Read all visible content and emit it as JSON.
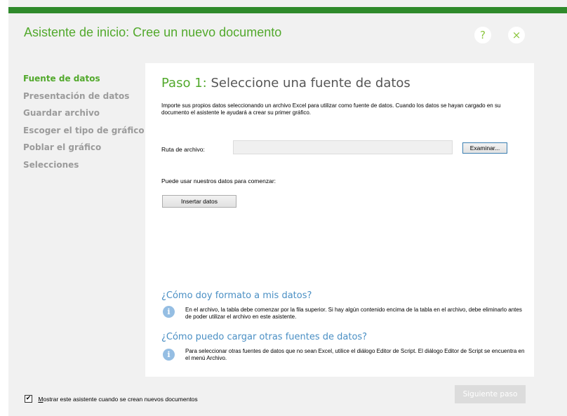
{
  "window": {
    "title": "Asistente de inicio: Cree un nuevo documento",
    "help_label": "?",
    "close_label": "×"
  },
  "sidebar": {
    "steps": [
      {
        "label": "Fuente de datos",
        "active": true
      },
      {
        "label": "Presentación de datos",
        "active": false
      },
      {
        "label": "Guardar archivo",
        "active": false
      },
      {
        "label": "Escoger el tipo de gráfico",
        "active": false
      },
      {
        "label": "Poblar el gráfico",
        "active": false
      },
      {
        "label": "Selecciones",
        "active": false
      }
    ]
  },
  "main": {
    "step_number": "Paso 1:",
    "step_title": "Seleccione una fuente de datos",
    "intro": "Importe sus propios datos seleccionando un archivo Excel para utilizar como fuente de datos. Cuando los datos se hayan cargado en su documento el asistente le ayudará a crear su primer gráfico.",
    "file_path_label": "Ruta de archivo:",
    "file_path_value": "",
    "browse_label": "Examinar...",
    "use_data_text": "Puede usar nuestros datos para comenzar:",
    "insert_data_label": "Insertar datos"
  },
  "faq": [
    {
      "title": "¿Cómo doy formato a mis datos?",
      "text": "En el archivo, la tabla debe comenzar por la fila superior. Si hay algún contenido encima de la tabla en el archivo, debe eliminarlo antes de poder utilizar el archivo en este asistente."
    },
    {
      "title": "¿Cómo puedo cargar otras fuentes de datos?",
      "text": "Para seleccionar otras fuentes de datos que no sean Excel, utilice el diálogo Editor de Script. El diálogo Editor de Script se encuentra en el menú Archivo."
    }
  ],
  "footer": {
    "next_label": "Siguiente paso",
    "checkbox_checked": true,
    "checkbox_mark": "✔",
    "show_wizard_accel": "M",
    "show_wizard_rest": "ostrar este asistente cuando se crean nuevos documentos"
  },
  "icons": {
    "info": "i"
  },
  "colors": {
    "accent_green": "#52a92c",
    "top_bar": "#2f8a2b",
    "faq_blue": "#4a8fc4",
    "inactive_step": "#9b9b9b",
    "disabled_button": "#dcdcdc"
  }
}
